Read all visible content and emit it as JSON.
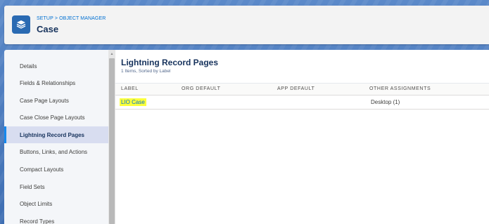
{
  "header": {
    "breadcrumb_setup": "SETUP",
    "breadcrumb_sep": ">",
    "breadcrumb_object_manager": "OBJECT MANAGER",
    "title": "Case",
    "icon": "layers-icon"
  },
  "sidebar": {
    "items": [
      {
        "label": "Details"
      },
      {
        "label": "Fields & Relationships"
      },
      {
        "label": "Case Page Layouts"
      },
      {
        "label": "Case Close Page Layouts"
      },
      {
        "label": "Lightning Record Pages",
        "active": true
      },
      {
        "label": "Buttons, Links, and Actions"
      },
      {
        "label": "Compact Layouts"
      },
      {
        "label": "Field Sets"
      },
      {
        "label": "Object Limits"
      },
      {
        "label": "Record Types"
      }
    ]
  },
  "main": {
    "title": "Lightning Record Pages",
    "subtitle": "1 Items, Sorted by Label",
    "columns": [
      "LABEL",
      "ORG DEFAULT",
      "APP DEFAULT",
      "OTHER ASSIGNMENTS"
    ],
    "rows": [
      {
        "label": "LIO Case",
        "org_default": "",
        "app_default": "",
        "other_assignments": "Desktop (1)"
      }
    ]
  },
  "colors": {
    "accent": "#0070d2",
    "highlight": "#fbff3a",
    "header_band": "#4f7fc0",
    "icon_bg": "#2a6ab2"
  }
}
